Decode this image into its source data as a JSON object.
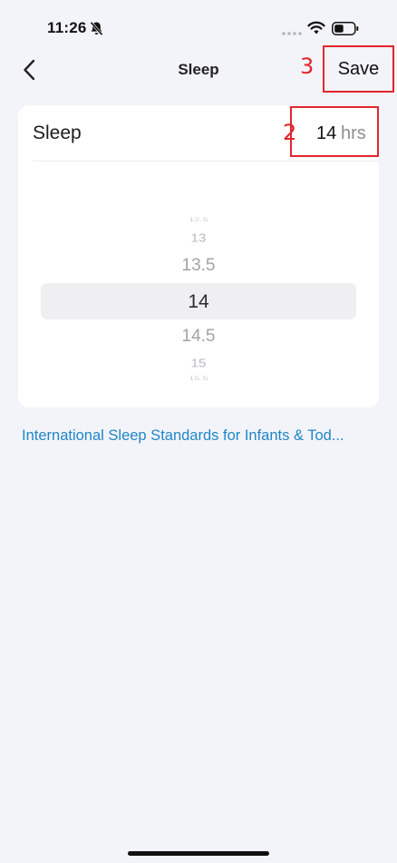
{
  "status_bar": {
    "time": "11:26",
    "icons": [
      "bell-slash-icon",
      "signal-dots-icon",
      "wifi-icon",
      "battery-icon"
    ]
  },
  "nav": {
    "title": "Sleep",
    "back_icon": "chevron-left-icon",
    "save_label": "Save",
    "annotation_save": "3"
  },
  "sleep_row": {
    "label": "Sleep",
    "value": "14",
    "unit": "hrs",
    "annotation_value": "2"
  },
  "picker": {
    "items": [
      "12.5",
      "13",
      "13.5",
      "14",
      "14.5",
      "15",
      "15.5"
    ],
    "selected": "14"
  },
  "link_text": "International Sleep Standards for Infants & Tod...",
  "colors": {
    "background": "#f3f4f9",
    "card": "#ffffff",
    "link": "#1f86c8",
    "annotation": "#e2262e"
  }
}
